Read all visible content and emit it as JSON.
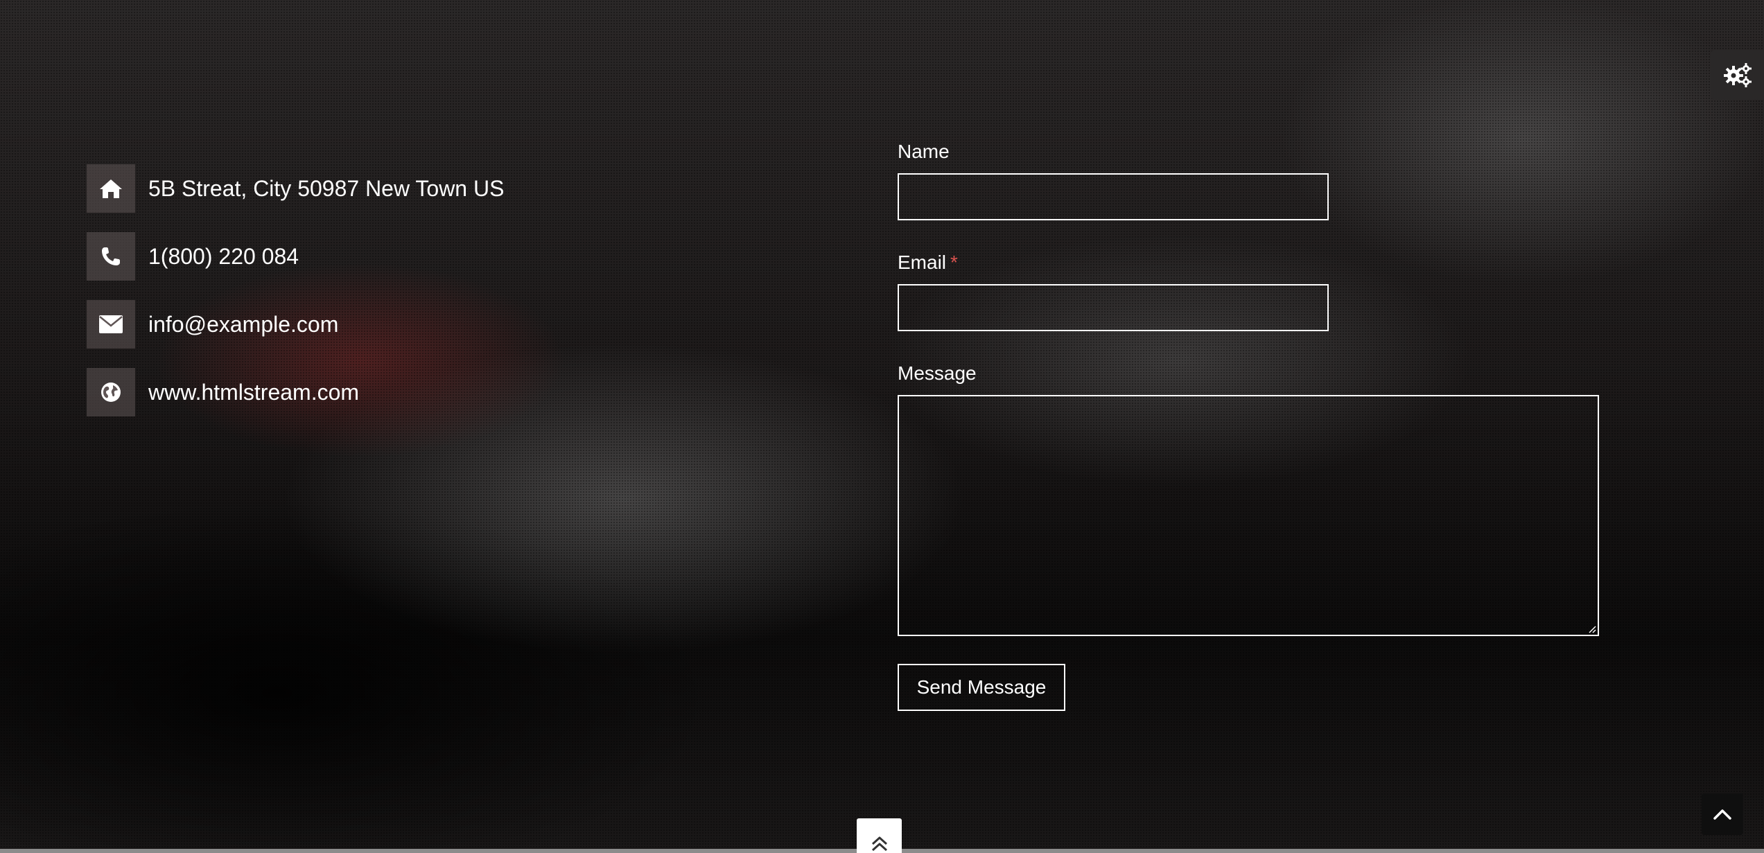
{
  "contact_info": {
    "items": [
      {
        "icon": "home-icon",
        "text": "5B Streat, City 50987 New Town US"
      },
      {
        "icon": "phone-icon",
        "text": "1(800) 220 084"
      },
      {
        "icon": "envelope-icon",
        "text": "info@example.com"
      },
      {
        "icon": "globe-icon",
        "text": "www.htmlstream.com"
      }
    ]
  },
  "form": {
    "name_label": "Name",
    "name_value": "",
    "email_label": "Email",
    "email_required_mark": "*",
    "email_value": "",
    "message_label": "Message",
    "message_value": "",
    "submit_label": "Send Message"
  },
  "widgets": {
    "settings_icon": "gears-icon",
    "scroll_top_icon": "chevron-up-icon",
    "center_up_icon": "double-chevron-up-icon"
  },
  "colors": {
    "required": "#d9534f",
    "text": "#ffffff",
    "icon_box": "#5f5555"
  }
}
